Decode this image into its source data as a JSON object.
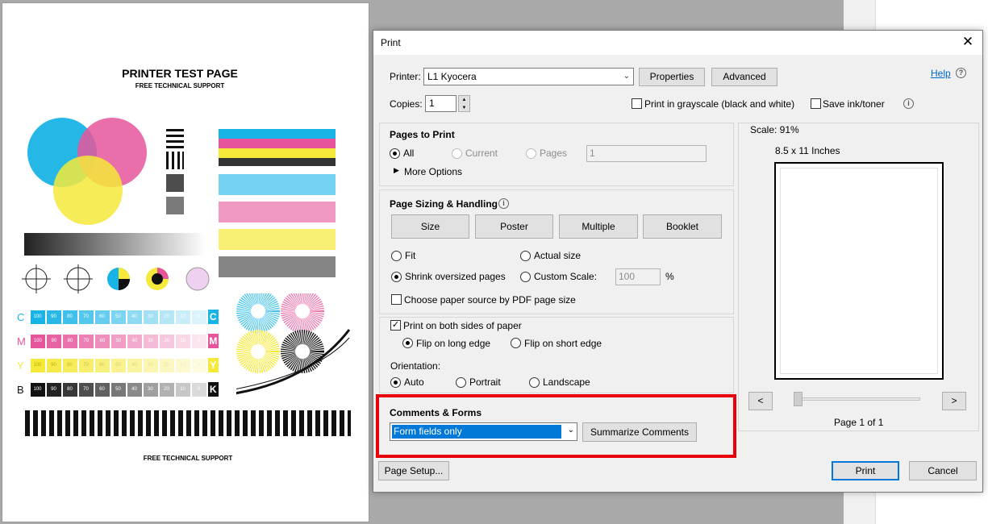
{
  "test_page": {
    "title": "PRINTER TEST PAGE",
    "subtitle": "FREE TECHNICAL SUPPORT",
    "footer": "FREE TECHNICAL SUPPORT",
    "scale_numbers": [
      "100",
      "90",
      "80",
      "70",
      "60",
      "50",
      "40",
      "30",
      "20",
      "10",
      "0"
    ],
    "rows": [
      {
        "letter": "C",
        "color": "#19b4e6"
      },
      {
        "letter": "M",
        "color": "#e6559b"
      },
      {
        "letter": "Y",
        "color": "#f5e93a"
      },
      {
        "letter": "B",
        "color": "#111111"
      }
    ]
  },
  "dialog": {
    "title": "Print",
    "close_icon": "close-icon",
    "printer_label": "Printer:",
    "printer_value": "L1 Kyocera",
    "properties_label": "Properties",
    "advanced_label": "Advanced",
    "help_label": "Help",
    "copies_label": "Copies:",
    "copies_value": "1",
    "grayscale_label": "Print in grayscale (black and white)",
    "save_ink_label": "Save ink/toner",
    "pages_to_print": {
      "heading": "Pages to Print",
      "all": "All",
      "current": "Current",
      "pages": "Pages",
      "pages_value": "1",
      "more_options": "More Options"
    },
    "sizing": {
      "heading": "Page Sizing & Handling",
      "size": "Size",
      "poster": "Poster",
      "multiple": "Multiple",
      "booklet": "Booklet",
      "fit": "Fit",
      "actual_size": "Actual size",
      "shrink": "Shrink oversized pages",
      "custom_scale": "Custom Scale:",
      "custom_scale_value": "100",
      "percent": "%",
      "choose_paper": "Choose paper source by PDF page size"
    },
    "duplex": {
      "both_sides": "Print on both sides of paper",
      "long_edge": "Flip on long edge",
      "short_edge": "Flip on short edge",
      "orientation_label": "Orientation:",
      "auto": "Auto",
      "portrait": "Portrait",
      "landscape": "Landscape"
    },
    "comments": {
      "heading": "Comments & Forms",
      "selected": "Form fields only",
      "summarize": "Summarize Comments"
    },
    "preview": {
      "scale": "Scale:  91%",
      "paper": "8.5 x 11 Inches",
      "prev": "<",
      "next": ">",
      "page_of": "Page 1 of 1"
    },
    "page_setup": "Page Setup...",
    "print": "Print",
    "cancel": "Cancel"
  }
}
